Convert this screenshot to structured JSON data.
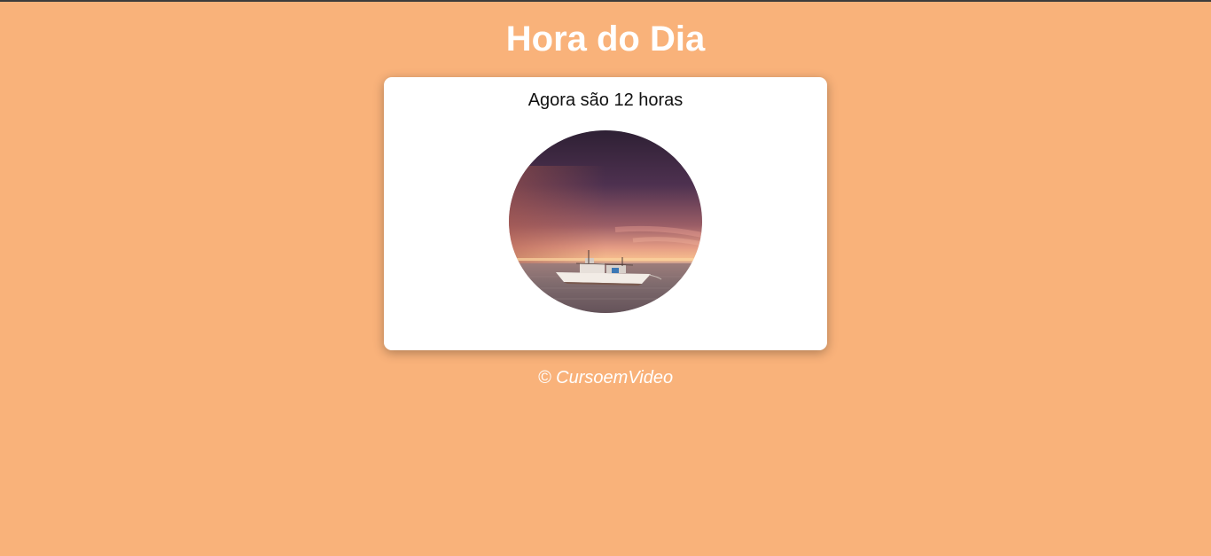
{
  "page": {
    "title": "Hora do Dia",
    "background_color": "#f9b27a"
  },
  "card": {
    "message": "Agora são 12 horas",
    "image_icon": "sunset-boat-photo"
  },
  "footer": {
    "text": "© CursoemVideo"
  }
}
